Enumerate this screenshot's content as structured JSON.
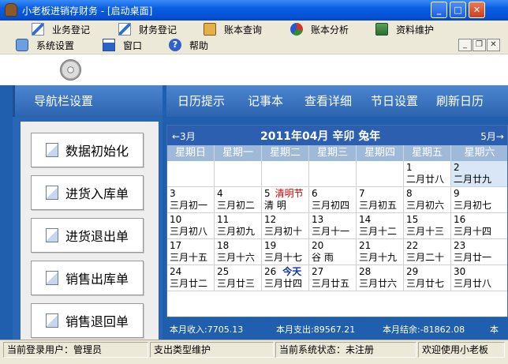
{
  "window": {
    "title": "小老板进销存财务 - [启动桌面]",
    "min": "_",
    "max": "□",
    "close": "✕"
  },
  "menu_row1": [
    {
      "label": "业务登记",
      "icon": "edit-icon"
    },
    {
      "label": "财务登记",
      "icon": "edit-icon"
    },
    {
      "label": "账本查询",
      "icon": "book-icon"
    },
    {
      "label": "账本分析",
      "icon": "chart-icon"
    },
    {
      "label": "资料维护",
      "icon": "database-icon"
    }
  ],
  "menu_row2": [
    {
      "label": "系统设置",
      "icon": "settings-icon"
    },
    {
      "label": "窗口",
      "icon": "window-icon"
    },
    {
      "label": "帮助",
      "icon": "help-icon"
    }
  ],
  "mdi": {
    "min": "_",
    "restore": "❐",
    "close": "✕"
  },
  "nav": {
    "header": "导航栏设置",
    "buttons": [
      "数据初始化",
      "进货入库单",
      "进货退出单",
      "销售出库单",
      "销售退回单"
    ]
  },
  "cal_tabs": [
    "日历提示",
    "记事本",
    "查看详细",
    "节日设置",
    "刷新日历"
  ],
  "calendar": {
    "prev": "←3月",
    "title": "2011年04月   辛卯  兔年",
    "next": "5月→",
    "weekdays": [
      "星期日",
      "星期一",
      "星期二",
      "星期三",
      "星期四",
      "星期五",
      "星期六"
    ],
    "weeks": [
      [
        null,
        null,
        null,
        null,
        null,
        {
          "d": "1",
          "l": "二月廿八"
        },
        {
          "d": "2",
          "l": "二月廿九"
        }
      ],
      [
        {
          "d": "3",
          "l": "三月初一"
        },
        {
          "d": "4",
          "l": "三月初二"
        },
        {
          "d": "5",
          "f": "清明节",
          "l": "清 明"
        },
        {
          "d": "6",
          "l": "三月初四"
        },
        {
          "d": "7",
          "l": "三月初五"
        },
        {
          "d": "8",
          "l": "三月初六"
        },
        {
          "d": "9",
          "l": "三月初七"
        }
      ],
      [
        {
          "d": "10",
          "l": "三月初八"
        },
        {
          "d": "11",
          "l": "三月初九"
        },
        {
          "d": "12",
          "l": "三月初十"
        },
        {
          "d": "13",
          "l": "三月十一"
        },
        {
          "d": "14",
          "l": "三月十二"
        },
        {
          "d": "15",
          "l": "三月十三"
        },
        {
          "d": "16",
          "l": "三月十四"
        }
      ],
      [
        {
          "d": "17",
          "l": "三月十五"
        },
        {
          "d": "18",
          "l": "三月十六"
        },
        {
          "d": "19",
          "l": "三月十七"
        },
        {
          "d": "20",
          "l": "谷 雨"
        },
        {
          "d": "21",
          "l": "三月十九"
        },
        {
          "d": "22",
          "l": "三月二十"
        },
        {
          "d": "23",
          "l": "三月廿一"
        }
      ],
      [
        {
          "d": "24",
          "l": "三月廿二"
        },
        {
          "d": "25",
          "l": "三月廿三"
        },
        {
          "d": "26",
          "t": "今天",
          "l": "三月廿四"
        },
        {
          "d": "27",
          "l": "三月廿五"
        },
        {
          "d": "28",
          "l": "三月廿六"
        },
        {
          "d": "29",
          "l": "三月廿七"
        },
        {
          "d": "30",
          "l": "三月廿八"
        }
      ]
    ],
    "footer": {
      "income": "本月收入:7705.13",
      "expense": "本月支出:89567.21",
      "balance": "本月结余:-81862.08",
      "more": "本"
    }
  },
  "status": {
    "user": "当前登录用户：管理员",
    "module": "支出类型维护",
    "state": "当前系统状态：未注册",
    "welcome": "欢迎使用小老板"
  }
}
